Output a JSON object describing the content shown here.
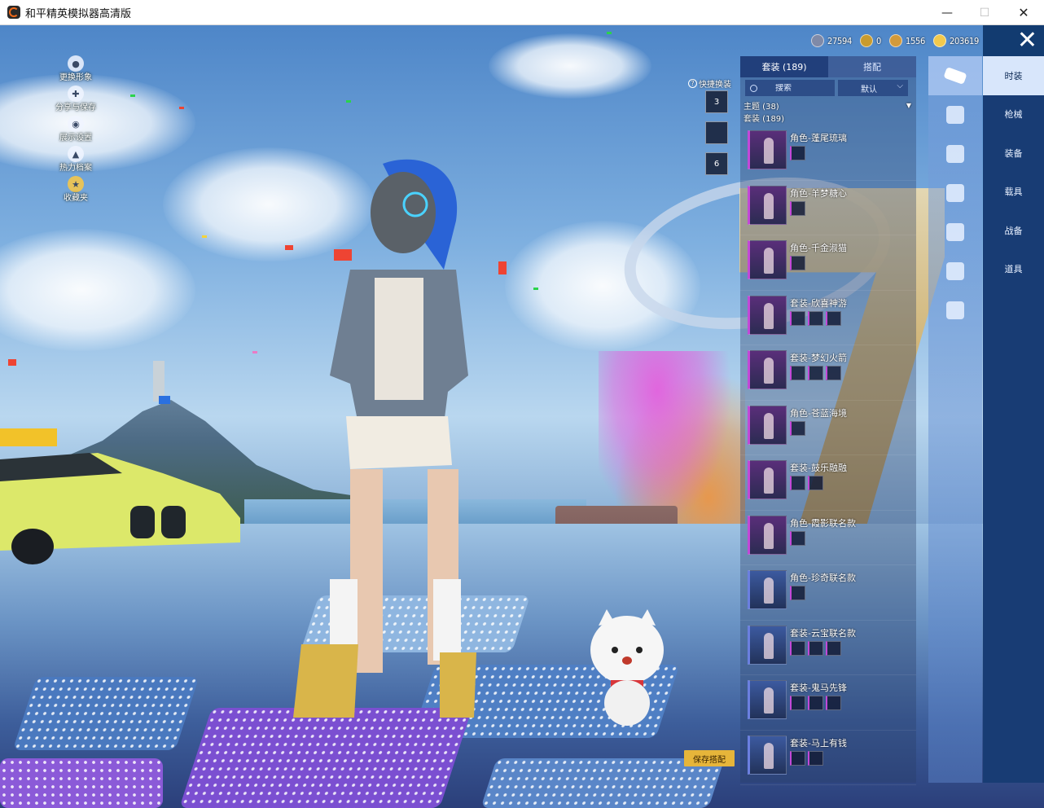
{
  "window": {
    "title": "和平精英模拟器高清版",
    "min": "—",
    "max": "☐",
    "close": "✕"
  },
  "left_menu": [
    {
      "label": "更换形象",
      "icon": "person-icon"
    },
    {
      "label": "分享与保存",
      "icon": "share-icon"
    },
    {
      "label": "展示设置",
      "icon": "eye-icon"
    },
    {
      "label": "热力档案",
      "icon": "flame-icon"
    },
    {
      "label": "收藏夹",
      "icon": "bookmark-icon"
    }
  ],
  "currency": [
    {
      "value": "27594",
      "color": "#7f8aa8"
    },
    {
      "value": "0",
      "color": "#c99b2e"
    },
    {
      "value": "1556",
      "color": "#d49a3a"
    },
    {
      "value": "203619",
      "color": "#f2c94c"
    }
  ],
  "close_panel": "✕",
  "quick_switch": {
    "label": "快捷换装",
    "help": "?",
    "slots": [
      "3",
      "",
      "6"
    ]
  },
  "tabs": [
    {
      "label": "套装 (189)",
      "active": true
    },
    {
      "label": "搭配",
      "active": false
    }
  ],
  "search": {
    "placeholder": "搜索",
    "sort": "默认"
  },
  "groups": {
    "theme": "主题 (38)",
    "suits": "套装 (189)"
  },
  "outfits": [
    {
      "name": "角色-蓬尾琉璃",
      "parts": 1
    },
    {
      "name": "角色-羊梦糖心",
      "parts": 1
    },
    {
      "name": "角色-千金淑猫",
      "parts": 1
    },
    {
      "name": "套装-欣喜神游",
      "parts": 3
    },
    {
      "name": "套装-梦幻火箭",
      "parts": 3
    },
    {
      "name": "角色-苍蓝海境",
      "parts": 1
    },
    {
      "name": "套装-鼓乐融融",
      "parts": 2
    },
    {
      "name": "角色-霞影联名款",
      "parts": 1
    },
    {
      "name": "角色-珍奇联名款",
      "parts": 1
    },
    {
      "name": "套装-云宝联名款",
      "parts": 3
    },
    {
      "name": "套装-鬼马先锋",
      "parts": 3
    },
    {
      "name": "套装-马上有钱",
      "parts": 2
    }
  ],
  "save_button": "保存搭配",
  "subcategory_icons": [
    "outfit-icon",
    "hat-icon",
    "shoe-icon",
    "mask-icon",
    "jacket-icon",
    "backpack-icon",
    "glove-icon"
  ],
  "categories": [
    {
      "label": "时装",
      "active": true
    },
    {
      "label": "枪械",
      "active": false
    },
    {
      "label": "装备",
      "active": false
    },
    {
      "label": "载具",
      "active": false
    },
    {
      "label": "战备",
      "active": false
    },
    {
      "label": "道具",
      "active": false
    }
  ]
}
